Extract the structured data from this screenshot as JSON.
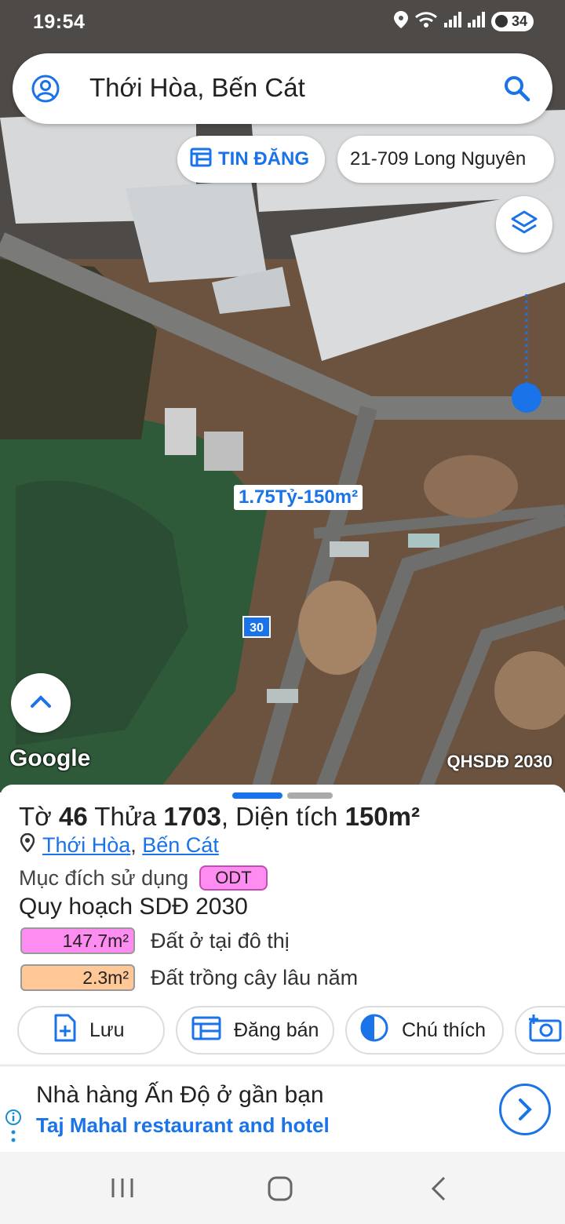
{
  "status_bar": {
    "time": "19:54",
    "battery": "34"
  },
  "search": {
    "query": "Thới Hòa, Bến Cát",
    "account_icon": "account-circle-icon",
    "search_icon": "search-icon"
  },
  "chips": {
    "listings_label": "TIN ĐĂNG",
    "address_label": "21-709 Long Nguyên"
  },
  "map": {
    "price_label": "1.75Tỷ-150m²",
    "marker_number": "30",
    "attribution": "Google",
    "layer_label": "QHSDĐ 2030",
    "location_color": "#1a73e8"
  },
  "parcel": {
    "prefix_sheet": "Tờ",
    "sheet_no": "46",
    "prefix_plot": "Thửa",
    "plot_no": "1703",
    "prefix_area": ", Diện tích",
    "area": "150m²",
    "ward": "Thới Hòa",
    "district": "Bến Cát",
    "purpose_label": "Mục đích sử dụng",
    "purpose_code": "ODT",
    "plan_title": "Quy hoạch SDĐ 2030",
    "plan_items": [
      {
        "area": "147.7m²",
        "label": "Đất ở tại đô thị",
        "color": "#ff8cf0"
      },
      {
        "area": "2.3m²",
        "label": "Đất trồng cây lâu năm",
        "color": "#ffc896"
      }
    ]
  },
  "actions": {
    "save": "Lưu",
    "post": "Đăng bán",
    "legend": "Chú thích"
  },
  "ad": {
    "title": "Nhà hàng Ấn Độ ở gần bạn",
    "subtitle": "Taj Mahal restaurant and hotel"
  }
}
